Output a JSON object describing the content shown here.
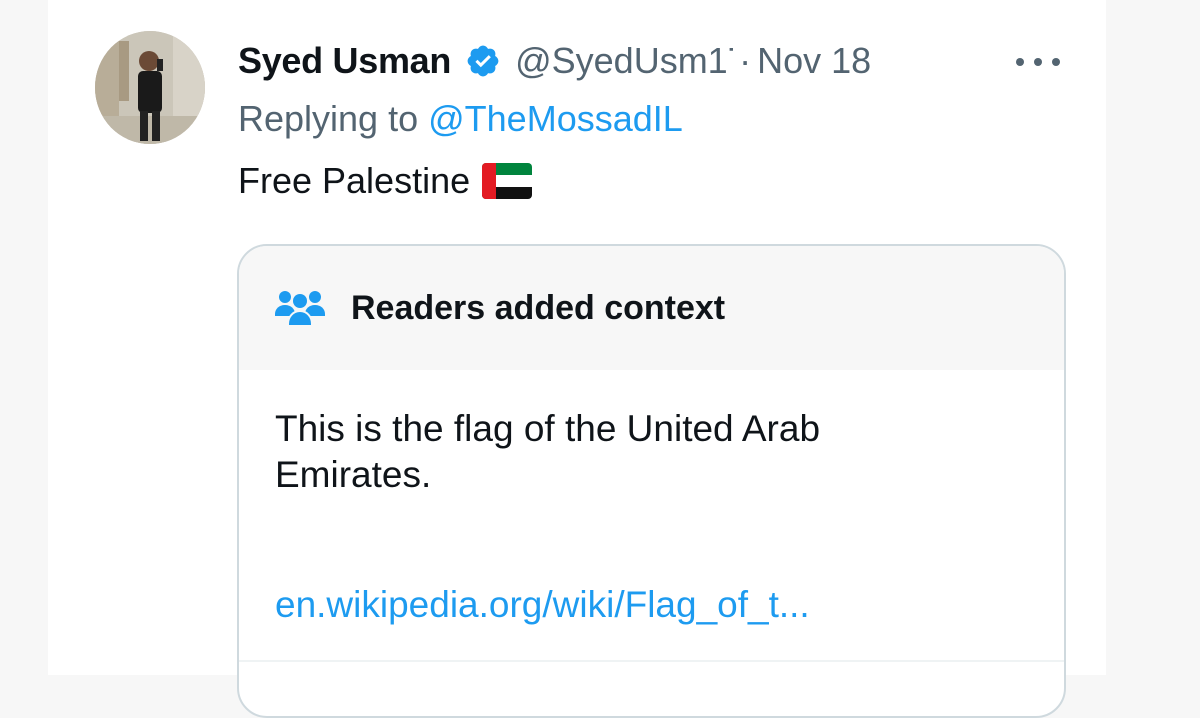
{
  "tweet": {
    "author_name": "Syed Usman",
    "handle": "@SyedUsm17!",
    "separator": "·",
    "date": "Nov 18",
    "replying_prefix": "Replying to",
    "replying_to": "@TheMossadIL",
    "text": "Free Palestine",
    "icons": {
      "verified": "verified-badge-icon",
      "more": "more-options-icon",
      "flag": "uae-flag-emoji"
    }
  },
  "community_note": {
    "icon": "readers-group-icon",
    "title": "Readers added context",
    "body": "This is the flag of the United Arab Emirates.",
    "link": "en.wikipedia.org/wiki/Flag_of_t..."
  },
  "colors": {
    "accent": "#1d9bf0",
    "text_primary": "#0f1419",
    "text_secondary": "#536471",
    "border": "#cfd9de"
  }
}
